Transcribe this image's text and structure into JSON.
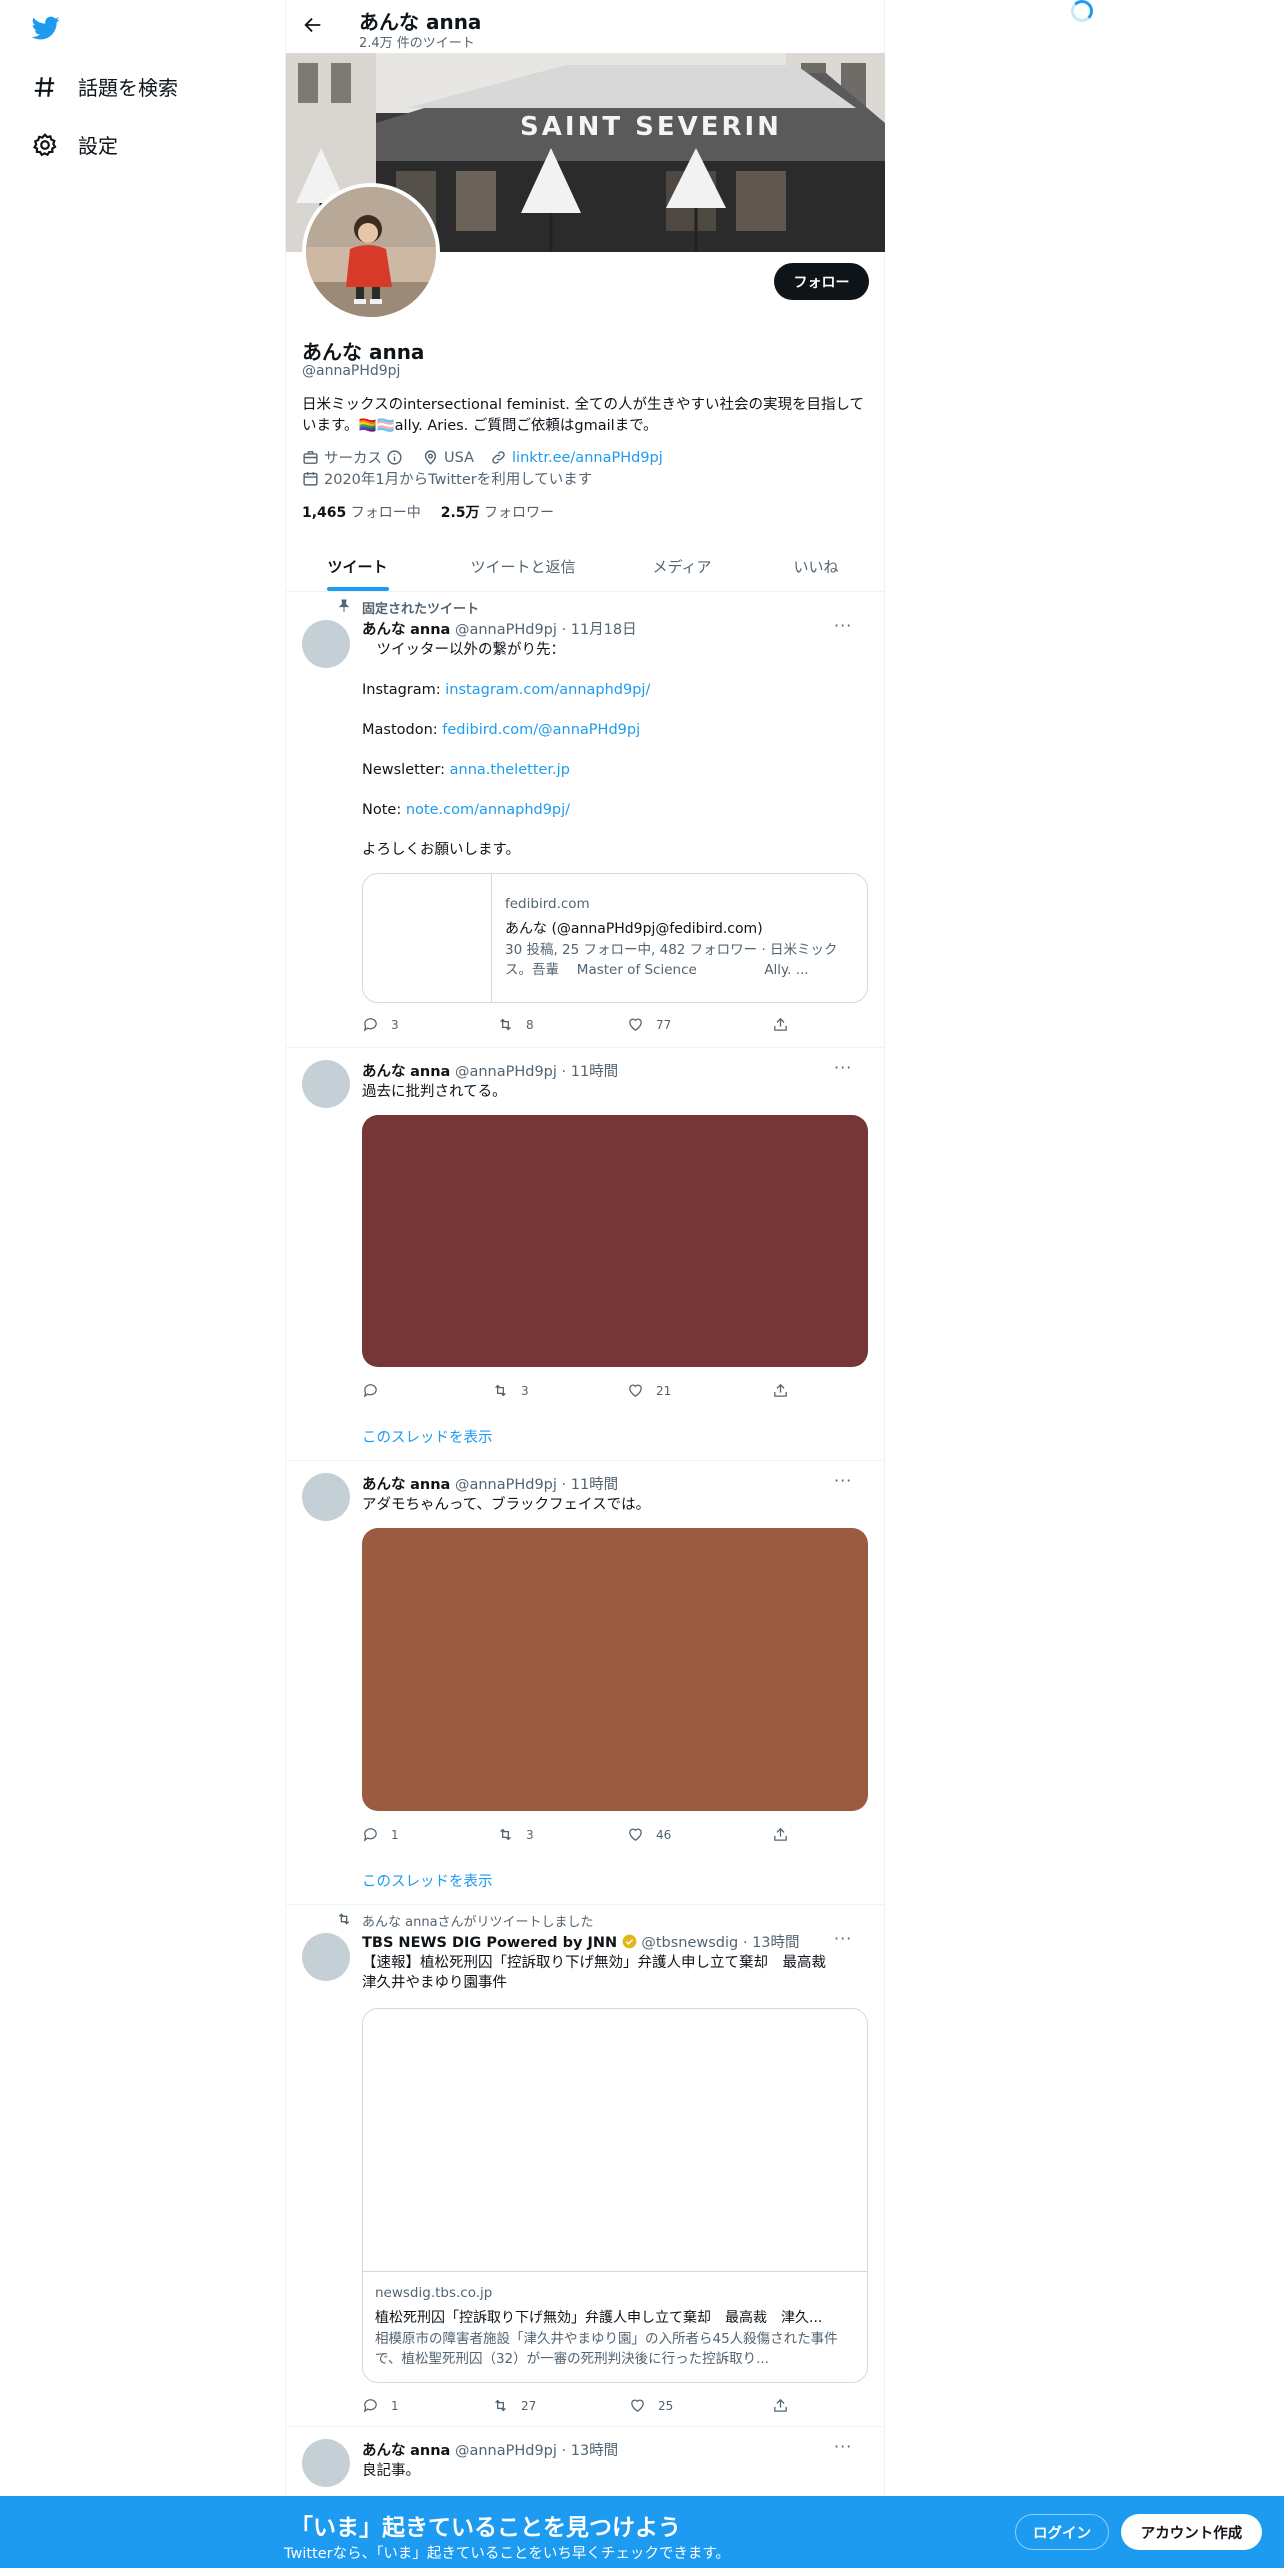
{
  "colors": {
    "accent": "#1d9bf0",
    "text": "#0f1419",
    "muted": "#536471",
    "bottom_bar": "#1d9bf0"
  },
  "nav": {
    "logo": "twitter-bird-icon",
    "explore_label": "話題を検索",
    "settings_label": "設定"
  },
  "header": {
    "title": "あんな anna",
    "tweet_count": "2.4万 件のツイート"
  },
  "banner": {
    "sign_text": "SAINT SEVERIN"
  },
  "profile": {
    "name": "あんな anna",
    "handle": "@annaPHd9pj",
    "bio": "日米ミックスのintersectional feminist. 全ての人が生きやすい社会の実現を目指しています。🏳️‍🌈🏳️‍⚧️ally. Aries. ご質問ご依頼はgmailまで。",
    "category": "サーカス",
    "location": "USA",
    "link": "linktr.ee/annaPHd9pj",
    "joined": "2020年1月からTwitterを利用しています",
    "following_count": "1,465",
    "following_label": "フォロー中",
    "followers_count": "2.5万",
    "followers_label": "フォロワー",
    "follow_button": "フォロー"
  },
  "tabs": [
    "ツイート",
    "ツイートと返信",
    "メディア",
    "いいね"
  ],
  "tweets": [
    {
      "context": "固定されたツイート",
      "name": "あんな",
      "name2": "anna",
      "handle": "@annaPHd9pj",
      "time": "· 11月18日",
      "lines": [
        "　ツイッター以外の繋がり先：",
        "",
        "Instagram: ",
        "",
        "Mastodon: ",
        "",
        "Newsletter: ",
        "",
        "Note: ",
        "",
        "よろしくお願いします。"
      ],
      "links": {
        "instagram": "instagram.com/annaphd9pj/",
        "mastodon": "fedibird.com/@annaPHd9pj",
        "newsletter": "anna.theletter.jp",
        "note": "note.com/annaphd9pj/"
      },
      "card": {
        "domain": "fedibird.com",
        "title": "あんな (@annaPHd9pj@fedibird.com)",
        "desc": "30 投稿, 25 フォロー中, 482 フォロワー · 日米ミックス。吾輩　 Master of Science　　　　　Ally. ..."
      },
      "replies": "3",
      "retweets": "8",
      "likes": "77"
    },
    {
      "name": "あんな",
      "name2": "anna",
      "handle": "@annaPHd9pj",
      "time": "· 11時間",
      "text": "過去に批判されてる。",
      "media_color": "#763536",
      "replies": "",
      "retweets": "3",
      "likes": "21",
      "show_thread": "このスレッドを表示"
    },
    {
      "name": "あんな",
      "name2": "anna",
      "handle": "@annaPHd9pj",
      "time": "· 11時間",
      "text": "アダモちゃんって、ブラックフェイスでは。",
      "media_color": "#9a5b40",
      "replies": "1",
      "retweets": "3",
      "likes": "46",
      "show_thread": "このスレッドを表示"
    },
    {
      "context": "あんな annaさんがリツイートしました",
      "name": "TBS NEWS DIG Powered by JNN",
      "handle": "@tbsnewsdig",
      "time": "· 13時間",
      "text": "【速報】植松死刑囚「控訴取り下げ無効」弁護人申し立て棄却　最高裁　津久井やまゆり園事件",
      "card": {
        "domain": "newsdig.tbs.co.jp",
        "title": "植松死刑囚「控訴取り下げ無効」弁護人申し立て棄却　最高裁　津久...",
        "desc": "相模原市の障害者施設「津久井やまゆり園」の入所者ら45人殺傷された事件で、植松聖死刑囚（32）が一審の死刑判決後に行った控訴取り..."
      },
      "replies": "1",
      "retweets": "27",
      "likes": "25"
    },
    {
      "name": "あんな",
      "name2": "anna",
      "handle": "@annaPHd9pj",
      "time": "· 13時間",
      "text": "良記事。"
    }
  ],
  "more_label": "···",
  "bottom": {
    "title": "「いま」起きていることを見つけよう",
    "subtitle": "Twitterなら、「いま」起きていることをいち早くチェックできます。",
    "login": "ログイン",
    "signup": "アカウント作成"
  }
}
